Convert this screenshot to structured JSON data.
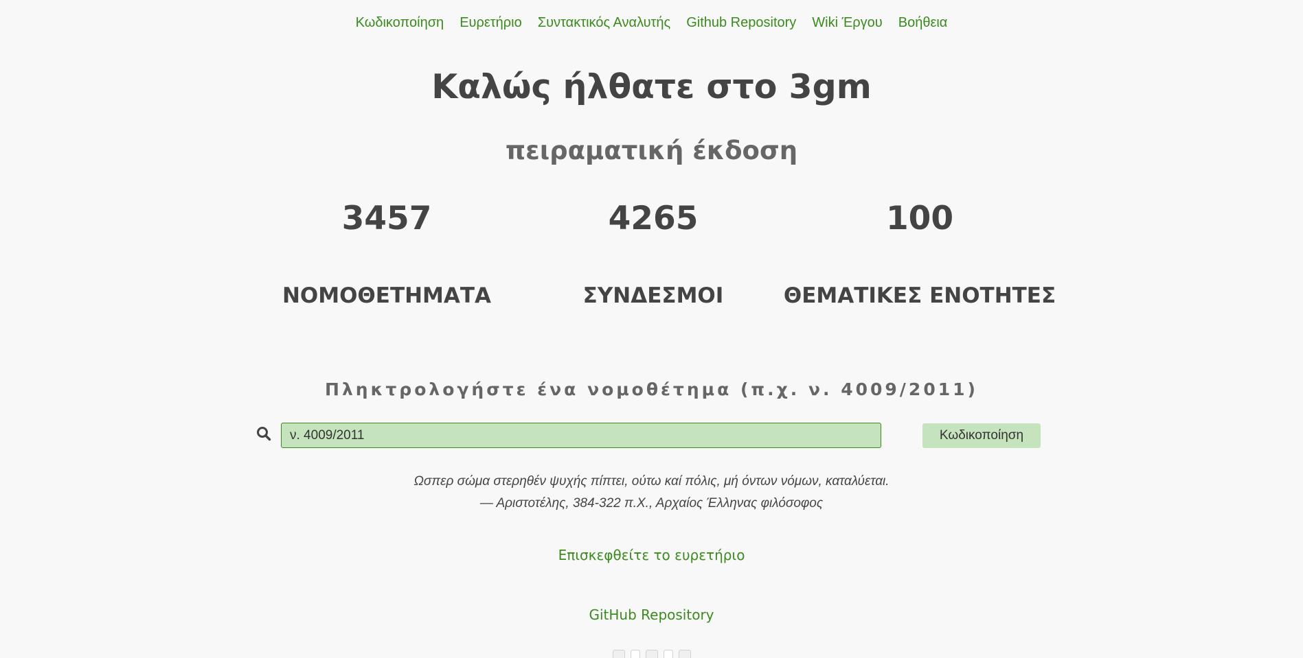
{
  "nav": {
    "items": [
      {
        "label": "Κωδικοποίηση"
      },
      {
        "label": "Ευρετήριο"
      },
      {
        "label": "Συντακτικός Αναλυτής"
      },
      {
        "label": "Github Repository"
      },
      {
        "label": "Wiki Έργου"
      },
      {
        "label": "Βοήθεια"
      }
    ]
  },
  "hero": {
    "title": "Καλώς ήλθατε στο 3gm",
    "subtitle": "πειραματική έκδοση"
  },
  "stats": [
    {
      "value": "3457",
      "label": "ΝΟΜΟΘΕΤΗΜΑΤΑ"
    },
    {
      "value": "4265",
      "label": "ΣΥΝΔΕΣΜΟΙ"
    },
    {
      "value": "100",
      "label": "ΘΕΜΑΤΙΚΕΣ ΕΝΟΤΗΤΕΣ"
    }
  ],
  "search": {
    "prompt": "Πληκτρολογήστε ένα νομοθέτημα (π.χ. ν. 4009/2011)",
    "value": "ν. 4009/2011",
    "button_label": "Κωδικοποίηση",
    "icon": "search-icon"
  },
  "quote": {
    "text": "Ωσπερ σώμα στερηθέν ψυχής πίπτει, ούτω καί πόλις, μή όντων νόμων, καταλύεται.",
    "attribution": "— Αριστοτέλης, 384-322 π.Χ., Αρχαίος Έλληνας φιλόσοφος"
  },
  "links": {
    "index": "Επισκεφθείτε το ευρετήριο",
    "github": "GitHub Repository"
  },
  "colors": {
    "accent": "#3b8a1e",
    "input_bg": "#c5e3bd",
    "text": "#444444",
    "background": "#f8f8f8"
  }
}
